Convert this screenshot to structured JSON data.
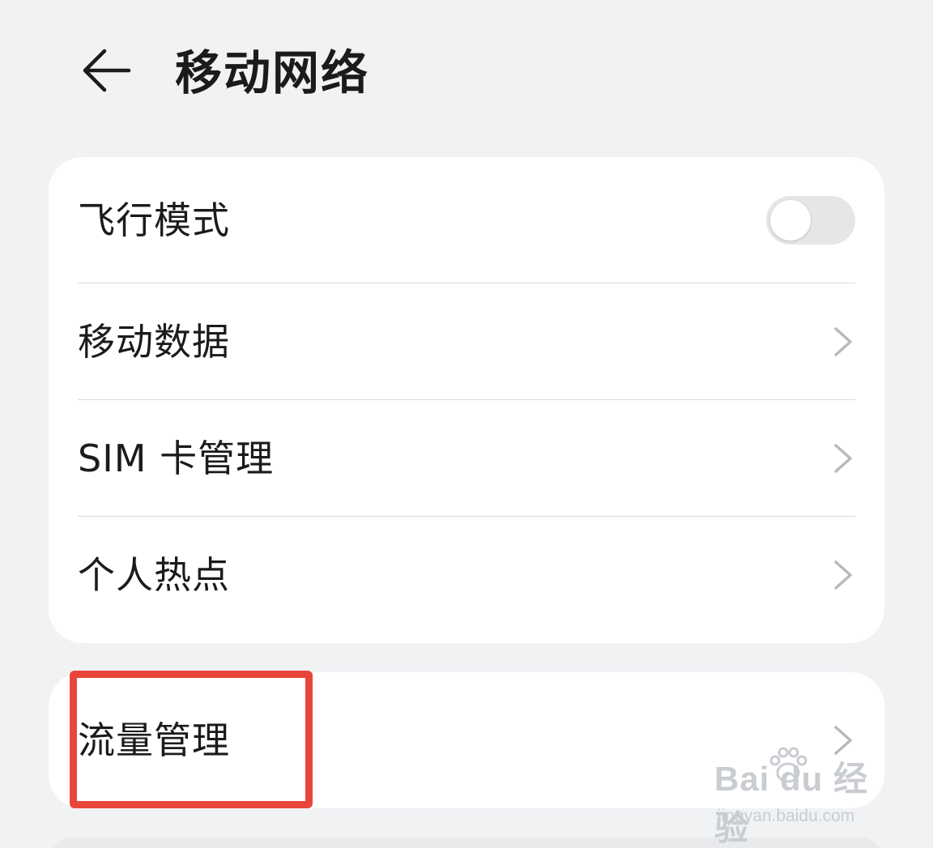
{
  "header": {
    "title": "移动网络"
  },
  "settings": {
    "airplane_mode": {
      "label": "飞行模式",
      "enabled": false
    },
    "items": [
      {
        "label": "移动数据"
      },
      {
        "label": "SIM 卡管理"
      },
      {
        "label": "个人热点"
      }
    ],
    "traffic": {
      "label": "流量管理"
    }
  },
  "watermark": {
    "brand": "Bai du 经验",
    "url": "jingyan.baidu.com"
  },
  "colors": {
    "background": "#f1f2f4",
    "card": "#ffffff",
    "highlight": "#e8463a",
    "toggle_off": "#e6e6e6"
  },
  "icons": {
    "back": "arrow-left-icon",
    "chevron": "chevron-right-icon"
  }
}
